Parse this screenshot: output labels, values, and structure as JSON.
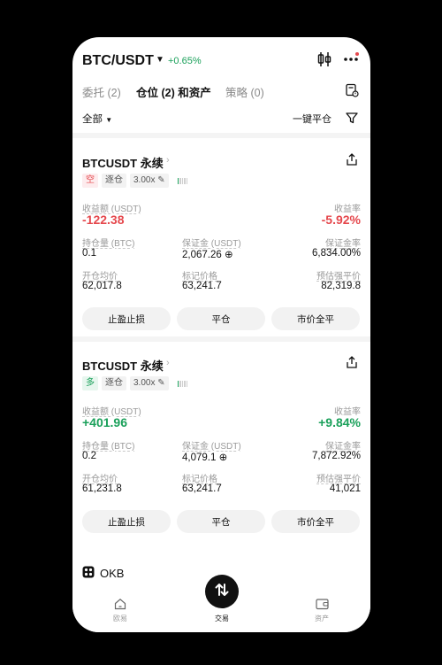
{
  "header": {
    "pair": "BTC/USDT",
    "change": "+0.65%"
  },
  "tabs": [
    {
      "label": "委托 (2)"
    },
    {
      "label": "仓位 (2) 和资产"
    },
    {
      "label": "策略 (0)"
    }
  ],
  "filter": {
    "all_label": "全部",
    "close_all_label": "一键平仓"
  },
  "positions": [
    {
      "title": "BTCUSDT 永续",
      "side": "空",
      "margin_mode": "逐仓",
      "leverage": "3.00x",
      "pnl_label": "收益额 (USDT)",
      "pnl": "-122.38",
      "roe_label": "收益率",
      "roe": "-5.92%",
      "size_label": "持仓量 (BTC)",
      "size": "0.1",
      "margin_label": "保证金 (USDT)",
      "margin": "2,067.26",
      "margin_ratio_label": "保证金率",
      "margin_ratio": "6,834.00%",
      "entry_label": "开仓均价",
      "entry": "62,017.8",
      "mark_label": "标记价格",
      "mark": "63,241.7",
      "liq_label": "预估强平价",
      "liq": "82,319.8",
      "buttons": [
        "止盈止损",
        "平仓",
        "市价全平"
      ]
    },
    {
      "title": "BTCUSDT 永续",
      "side": "多",
      "margin_mode": "逐仓",
      "leverage": "3.00x",
      "pnl_label": "收益额 (USDT)",
      "pnl": "+401.96",
      "roe_label": "收益率",
      "roe": "+9.84%",
      "size_label": "持仓量 (BTC)",
      "size": "0.2",
      "margin_label": "保证金 (USDT)",
      "margin": "4,079.1",
      "margin_ratio_label": "保证金率",
      "margin_ratio": "7,872.92%",
      "entry_label": "开仓均价",
      "entry": "61,231.8",
      "mark_label": "标记价格",
      "mark": "63,241.7",
      "liq_label": "预估强平价",
      "liq": "41,021",
      "buttons": [
        "止盈止损",
        "平仓",
        "市价全平"
      ]
    }
  ],
  "asset": {
    "name": "OKB"
  },
  "nav": [
    {
      "label": "欧易",
      "icon": "home-icon"
    },
    {
      "label": "交易",
      "icon": "trade-icon"
    },
    {
      "label": "资产",
      "icon": "wallet-icon"
    }
  ],
  "colors": {
    "up": "#1aa05a",
    "down": "#e5484d"
  }
}
